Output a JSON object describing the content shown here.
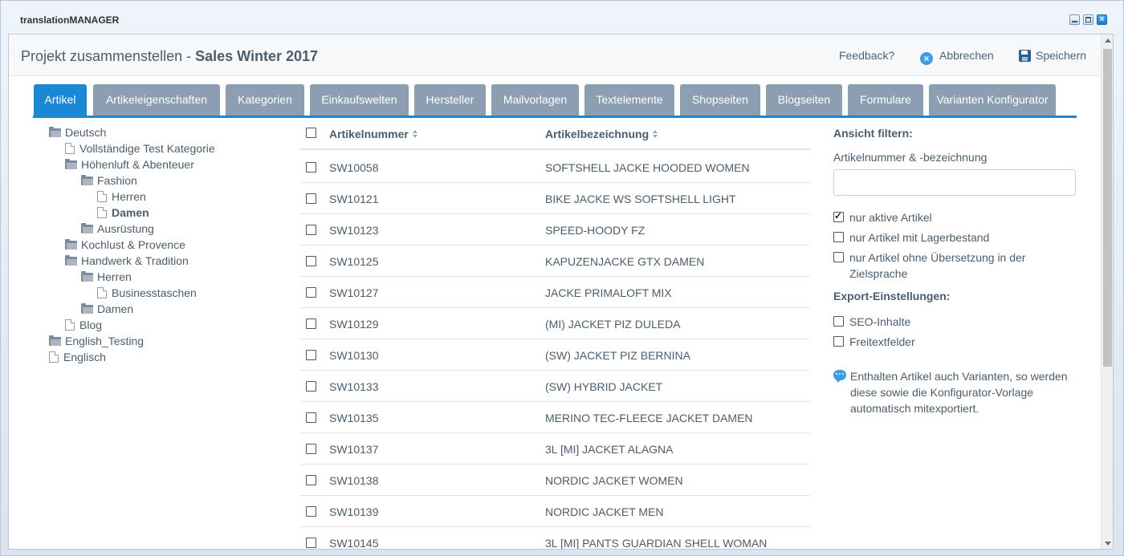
{
  "window": {
    "title": "translationMANAGER"
  },
  "header": {
    "title_prefix": "Projekt zusammenstellen - ",
    "title_project": "Sales Winter 2017",
    "feedback_label": "Feedback?",
    "cancel_label": "Abbrechen",
    "save_label": "Speichern"
  },
  "tabs": [
    {
      "label": "Artikel",
      "active": true
    },
    {
      "label": "Artikeleigenschaften"
    },
    {
      "label": "Kategorien"
    },
    {
      "label": "Einkaufswelten"
    },
    {
      "label": "Hersteller"
    },
    {
      "label": "Mailvorlagen"
    },
    {
      "label": "Textelemente"
    },
    {
      "label": "Shopseiten"
    },
    {
      "label": "Blogseiten"
    },
    {
      "label": "Formulare"
    },
    {
      "label": "Varianten Konfigurator"
    }
  ],
  "tree": [
    {
      "label": "Deutsch",
      "icon": "folder-open-icon",
      "level": 0
    },
    {
      "label": "Vollständige Test Kategorie",
      "icon": "file-icon",
      "level": 1
    },
    {
      "label": "Höhenluft & Abenteuer",
      "icon": "folder-open-icon",
      "level": 1
    },
    {
      "label": "Fashion",
      "icon": "folder-open-icon",
      "level": 2
    },
    {
      "label": "Herren",
      "icon": "file-icon",
      "level": 3
    },
    {
      "label": "Damen",
      "icon": "file-icon",
      "level": 3,
      "selected": true
    },
    {
      "label": "Ausrüstung",
      "icon": "folder-icon",
      "level": 2
    },
    {
      "label": "Kochlust & Provence",
      "icon": "folder-icon",
      "level": 1
    },
    {
      "label": "Handwerk & Tradition",
      "icon": "folder-open-icon",
      "level": 1
    },
    {
      "label": "Herren",
      "icon": "folder-open-icon",
      "level": 2
    },
    {
      "label": "Businesstaschen",
      "icon": "file-icon",
      "level": 3
    },
    {
      "label": "Damen",
      "icon": "folder-icon",
      "level": 2
    },
    {
      "label": "Blog",
      "icon": "file-icon",
      "level": 1
    },
    {
      "label": "English_Testing",
      "icon": "folder-icon",
      "level": 0
    },
    {
      "label": "Englisch",
      "icon": "file-icon",
      "level": 0
    }
  ],
  "table": {
    "columns": [
      "Artikelnummer",
      "Artikelbezeichnung"
    ],
    "rows": [
      [
        "SW10058",
        "SOFTSHELL JACKE HOODED WOMEN"
      ],
      [
        "SW10121",
        "BIKE JACKE WS SOFTSHELL LIGHT"
      ],
      [
        "SW10123",
        "SPEED-HOODY FZ"
      ],
      [
        "SW10125",
        "KAPUZENJACKE GTX DAMEN"
      ],
      [
        "SW10127",
        "JACKE PRIMALOFT MIX"
      ],
      [
        "SW10129",
        "(MI) JACKET PIZ DULEDA"
      ],
      [
        "SW10130",
        "(SW) JACKET PIZ BERNINA"
      ],
      [
        "SW10133",
        "(SW) HYBRID JACKET"
      ],
      [
        "SW10135",
        "MERINO TEC-FLEECE JACKET DAMEN"
      ],
      [
        "SW10137",
        "3L [MI] JACKET ALAGNA"
      ],
      [
        "SW10138",
        "NORDIC JACKET WOMEN"
      ],
      [
        "SW10139",
        "NORDIC JACKET MEN"
      ],
      [
        "SW10145",
        "3L [MI] PANTS GUARDIAN SHELL WOMAN"
      ]
    ]
  },
  "filter": {
    "heading": "Ansicht filtern:",
    "search_label": "Artikelnummer & -bezeichnung",
    "search_value": "",
    "checks": [
      {
        "label": "nur aktive Artikel",
        "checked": true
      },
      {
        "label": "nur Artikel mit Lagerbestand",
        "checked": false
      },
      {
        "label": "nur Artikel ohne Übersetzung in der Zielsprache",
        "checked": false
      }
    ],
    "export_heading": "Export-Einstellungen:",
    "export_checks": [
      {
        "label": "SEO-Inhalte",
        "checked": false
      },
      {
        "label": "Freitextfelder",
        "checked": false
      }
    ],
    "info_text": "Enthalten Artikel auch Varianten, so werden diese sowie die Konfigurator-Vorlage automatisch mitexportiert."
  }
}
